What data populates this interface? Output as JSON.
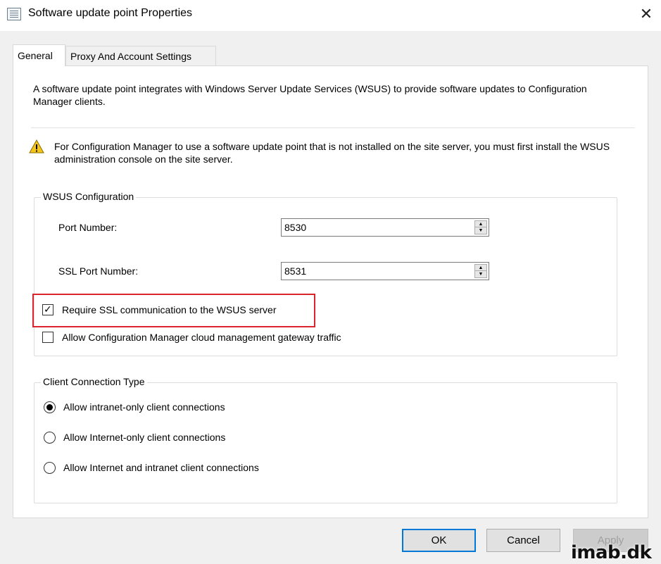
{
  "window": {
    "title": "Software update point Properties",
    "close_glyph": "✕",
    "icon": "properties-sheet-icon"
  },
  "tabs": [
    {
      "label": "General",
      "selected": true
    },
    {
      "label": "Proxy And Account Settings",
      "selected": false
    }
  ],
  "intro_text": "A software update point integrates with Windows Server Update Services (WSUS) to provide software updates to Configuration Manager clients.",
  "warning": {
    "icon": "warning-triangle-icon",
    "text": "For Configuration Manager to use a software update point that is not installed on the site server, you must first install the WSUS administration console on the site server."
  },
  "wsus_group": {
    "label": "WSUS Configuration",
    "port_label": "Port Number:",
    "port_value": "8530",
    "ssl_port_label": "SSL Port Number:",
    "ssl_port_value": "8531",
    "require_ssl": {
      "label": "Require SSL communication to the WSUS server",
      "checked": true
    },
    "allow_cmg": {
      "label": "Allow Configuration Manager cloud management gateway traffic",
      "checked": false
    }
  },
  "client_group": {
    "label": "Client Connection Type",
    "options": [
      {
        "label": "Allow intranet-only client connections",
        "selected": true
      },
      {
        "label": "Allow Internet-only client connections",
        "selected": false
      },
      {
        "label": "Allow Internet and intranet client connections",
        "selected": false
      }
    ]
  },
  "buttons": {
    "ok": "OK",
    "cancel": "Cancel",
    "apply": "Apply"
  },
  "watermark": "imab.dk",
  "colors": {
    "highlight_box": "#d9262e",
    "default_button_border": "#0078d7",
    "warning_yellow": "#f5c518"
  }
}
